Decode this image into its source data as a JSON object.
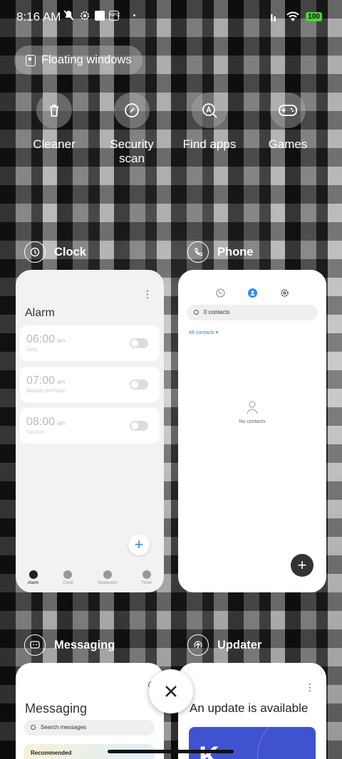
{
  "status_bar": {
    "time": "8:16 AM",
    "battery": "100"
  },
  "floating_windows": {
    "label": "Floating windows"
  },
  "quick_actions": [
    {
      "label": "Cleaner",
      "icon": "trash-icon"
    },
    {
      "label": "Security\nscan",
      "icon": "security-scan-icon"
    },
    {
      "label": "Find apps",
      "icon": "find-apps-icon"
    },
    {
      "label": "Games",
      "icon": "gamepad-icon"
    }
  ],
  "apps": {
    "clock": {
      "title": "Clock",
      "alarm_title": "Alarm",
      "alarms": [
        {
          "time": "06:00",
          "ampm": "am",
          "repeat": "Daily"
        },
        {
          "time": "07:00",
          "ampm": "am",
          "repeat": "Monday to Friday"
        },
        {
          "time": "08:00",
          "ampm": "am",
          "repeat": "Sat Sun"
        }
      ],
      "tabs": [
        "Alarm",
        "Clock",
        "Stopwatch",
        "Timer"
      ]
    },
    "phone": {
      "title": "Phone",
      "search_text": "0 contacts",
      "all_contacts": "All contacts",
      "empty_text": "No contacts"
    },
    "messaging": {
      "title": "Messaging",
      "header": "Messaging",
      "search_placeholder": "Search messages",
      "recommended": "Recommended"
    },
    "updater": {
      "title": "Updater",
      "headline": "An update is available",
      "banner_letter": "K"
    }
  },
  "colors": {
    "accent_blue": "#2b8ef0",
    "battery_green": "#4cd137",
    "updater_banner": "#3f52d0"
  }
}
